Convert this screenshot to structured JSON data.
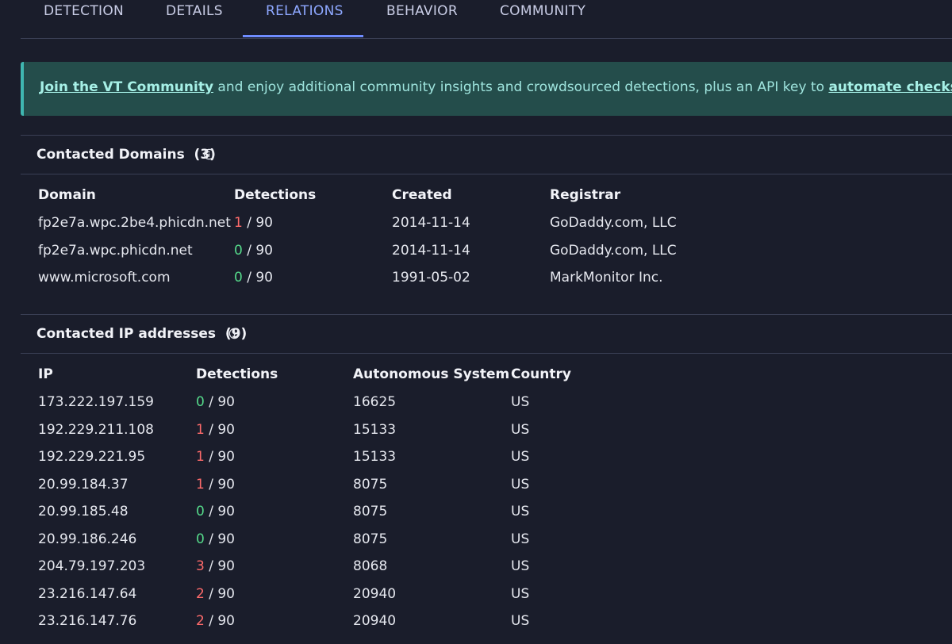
{
  "tabs": [
    {
      "label": "DETECTION",
      "active": false
    },
    {
      "label": "DETAILS",
      "active": false
    },
    {
      "label": "RELATIONS",
      "active": true
    },
    {
      "label": "BEHAVIOR",
      "active": false
    },
    {
      "label": "COMMUNITY",
      "active": false
    }
  ],
  "banner": {
    "link1": "Join the VT Community",
    "middle": " and enjoy additional community insights and crowdsourced detections, plus an API key to ",
    "link2": "automate checks."
  },
  "colors": {
    "accent": "#6f8cff",
    "malicious": "#ff6b6b",
    "clean": "#55d98a",
    "banner_bg": "#244d4b"
  },
  "contacted_domains": {
    "title": "Contacted Domains",
    "count": "(3)",
    "info_icon": "info-icon",
    "columns": [
      "Domain",
      "Detections",
      "Created",
      "Registrar"
    ],
    "rows": [
      {
        "domain": "fp2e7a.wpc.2be4.phicdn.net",
        "det": "1",
        "total": " / 90",
        "created": "2014-11-14",
        "registrar": "GoDaddy.com, LLC",
        "status": "malicious"
      },
      {
        "domain": "fp2e7a.wpc.phicdn.net",
        "det": "0",
        "total": " / 90",
        "created": "2014-11-14",
        "registrar": "GoDaddy.com, LLC",
        "status": "clean"
      },
      {
        "domain": "www.microsoft.com",
        "det": "0",
        "total": " / 90",
        "created": "1991-05-02",
        "registrar": "MarkMonitor Inc.",
        "status": "clean"
      }
    ]
  },
  "contacted_ips": {
    "title": "Contacted IP addresses",
    "count": "(9)",
    "info_icon": "info-icon",
    "columns": [
      "IP",
      "Detections",
      "Autonomous System",
      "Country"
    ],
    "rows": [
      {
        "ip": "173.222.197.159",
        "det": "0",
        "total": " / 90",
        "as": "16625",
        "country": "US",
        "status": "clean"
      },
      {
        "ip": "192.229.211.108",
        "det": "1",
        "total": " / 90",
        "as": "15133",
        "country": "US",
        "status": "malicious"
      },
      {
        "ip": "192.229.221.95",
        "det": "1",
        "total": " / 90",
        "as": "15133",
        "country": "US",
        "status": "malicious"
      },
      {
        "ip": "20.99.184.37",
        "det": "1",
        "total": " / 90",
        "as": "8075",
        "country": "US",
        "status": "malicious"
      },
      {
        "ip": "20.99.185.48",
        "det": "0",
        "total": " / 90",
        "as": "8075",
        "country": "US",
        "status": "clean"
      },
      {
        "ip": "20.99.186.246",
        "det": "0",
        "total": " / 90",
        "as": "8075",
        "country": "US",
        "status": "clean"
      },
      {
        "ip": "204.79.197.203",
        "det": "3",
        "total": " / 90",
        "as": "8068",
        "country": "US",
        "status": "malicious"
      },
      {
        "ip": "23.216.147.64",
        "det": "2",
        "total": " / 90",
        "as": "20940",
        "country": "US",
        "status": "malicious"
      },
      {
        "ip": "23.216.147.76",
        "det": "2",
        "total": " / 90",
        "as": "20940",
        "country": "US",
        "status": "malicious"
      }
    ]
  }
}
